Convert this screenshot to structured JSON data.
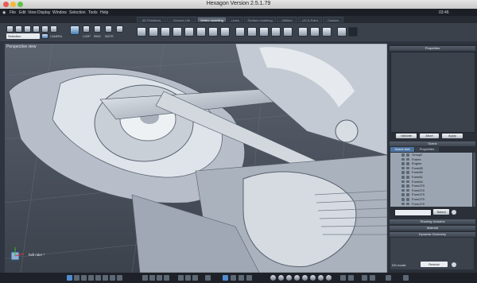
{
  "window": {
    "title": "Hexagon Version 2.5.1.79",
    "clock": "03:46"
  },
  "menu": [
    "File",
    "Edit",
    "View",
    "Display",
    "Window",
    "Selection",
    "Tools",
    "Help"
  ],
  "mode_tabs": [
    {
      "label": "3D Primitives",
      "active": false
    },
    {
      "label": "Second Life",
      "active": false
    },
    {
      "label": "Vertex modeling",
      "active": true
    },
    {
      "label": "Lines",
      "active": false
    },
    {
      "label": "Surface modeling",
      "active": false
    },
    {
      "label": "Utilities",
      "active": false
    },
    {
      "label": "UV & Paint",
      "active": false
    },
    {
      "label": "Custom",
      "active": false
    }
  ],
  "toolbar": {
    "selection_label": "Selection",
    "camera_label": "CAMERA",
    "loop_label": "LOOP",
    "ring_label": "RING",
    "instr_label": "INSTR"
  },
  "viewport": {
    "label": "Perspective view",
    "file_label": "hell rider *"
  },
  "panels": {
    "properties": "Properties",
    "validate": "Validate",
    "abort": "Abort",
    "apply": "Apply",
    "scene": "Scene",
    "tab_scene_tree": "Scene tree",
    "tab_properties": "Properties",
    "select_label": "Select",
    "shading": "Shading domains",
    "material": "Material",
    "dynamic_geometry": "Dynamic Geometry",
    "dg_mode_label": "DG mode:",
    "dg_mode_value": "Restrict"
  },
  "scene_tree": [
    {
      "name": "Group2",
      "selected": false
    },
    {
      "name": "Frame",
      "selected": false
    },
    {
      "name": "Engine",
      "selected": false
    },
    {
      "name": "Form65",
      "selected": false
    },
    {
      "name": "Form50",
      "selected": false
    },
    {
      "name": "Form61",
      "selected": false
    },
    {
      "name": "Form64",
      "selected": false
    },
    {
      "name": "Form270",
      "selected": false
    },
    {
      "name": "Form270",
      "selected": false
    },
    {
      "name": "Form270",
      "selected": false
    },
    {
      "name": "Form270",
      "selected": false
    },
    {
      "name": "Form270",
      "selected": false
    }
  ],
  "colors": {
    "accent": "#4f8ccf",
    "panel": "#2b3038",
    "viewport_bg": "#2a2f36"
  }
}
